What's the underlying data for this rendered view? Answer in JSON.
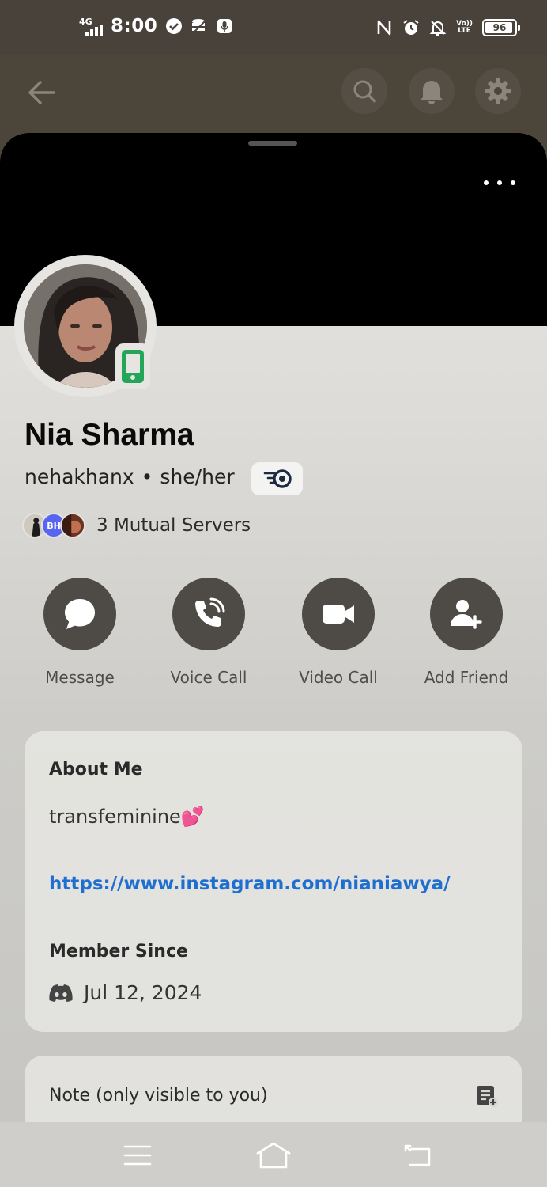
{
  "status_bar": {
    "network": "4G",
    "time": "8:00",
    "battery": "96",
    "volte_top": "Vo))",
    "volte_bottom": "LTE"
  },
  "top_bar": {
    "back_icon": "arrow-left-icon",
    "search_icon": "search-icon",
    "bell_icon": "bell-icon",
    "settings_icon": "gear-icon"
  },
  "profile": {
    "display_name": "Nia Sharma",
    "username": "nehakhanx",
    "separator": "•",
    "pronouns": "she/her",
    "status": "mobile",
    "mutual_server_badge": "BH",
    "mutual_servers": "3 Mutual Servers"
  },
  "actions": [
    {
      "label": "Message",
      "icon": "chat-bubble-icon"
    },
    {
      "label": "Voice Call",
      "icon": "phone-call-icon"
    },
    {
      "label": "Video Call",
      "icon": "video-camera-icon"
    },
    {
      "label": "Add Friend",
      "icon": "add-friend-icon"
    }
  ],
  "about": {
    "title": "About Me",
    "bio": "transfeminine",
    "bio_emoji": "💕",
    "link": "https://www.instagram.com/nianiawya/",
    "member_since_title": "Member Since",
    "member_since": "Jul 12, 2024"
  },
  "note": {
    "title": "Note (only visible to you)"
  },
  "colors": {
    "status_bar_bg": "#48423a",
    "action_circle": "#4e4a45",
    "link": "#1f6fd1",
    "online_mobile": "#23a55a",
    "blurple": "#5865f2"
  }
}
